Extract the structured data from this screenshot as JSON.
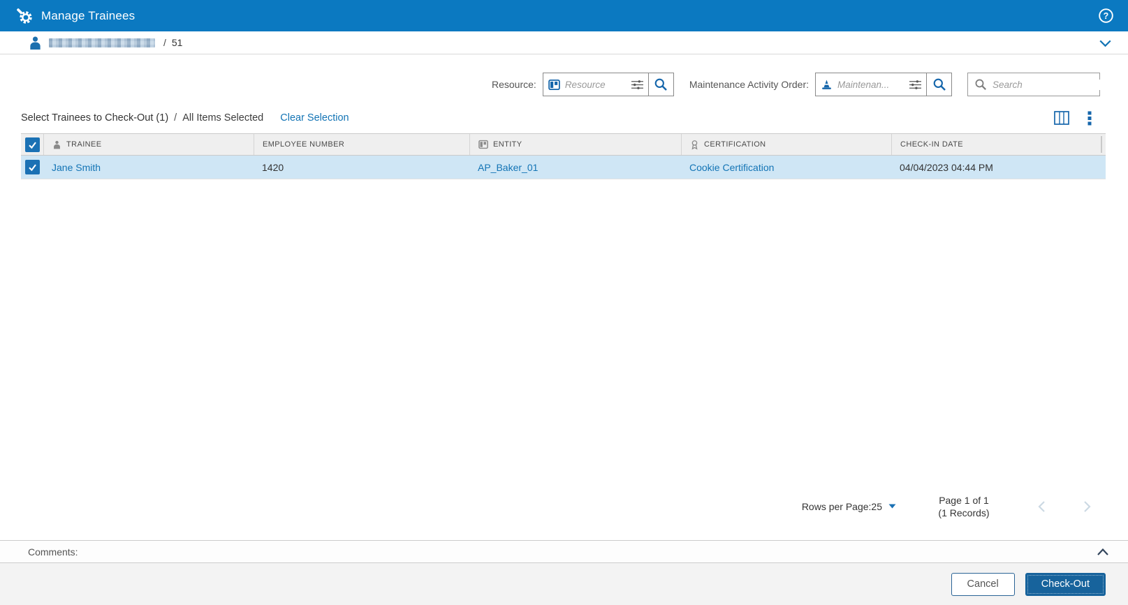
{
  "colors": {
    "titlebar_bg": "#0b79c1",
    "link_blue": "#1374b5",
    "icon_blue": "#1566ab",
    "selected_row_bg": "#cfe6f5",
    "table_header_bg": "#efefef",
    "checkout_button_bg": "#17639c",
    "footer_bg": "#f3f3f3"
  },
  "titlebar": {
    "title": "Manage Trainees",
    "icons": [
      "gear-wrench-icon",
      "help-icon"
    ]
  },
  "breadcrumb": {
    "user_icon": "person-icon",
    "user_name_redacted": true,
    "separator": "/",
    "count": "51",
    "collapse_icon": "chevron-down-icon"
  },
  "filters": {
    "resource_label": "Resource:",
    "resource_placeholder": "Resource",
    "resource_icons": [
      "resource-icon",
      "sliders-icon",
      "search-icon"
    ],
    "mao_label": "Maintenance Activity Order:",
    "mao_placeholder": "Maintenan...",
    "mao_icons": [
      "cone-icon",
      "sliders-icon",
      "search-icon"
    ],
    "search_placeholder": "Search",
    "search_icon": "search-icon"
  },
  "selection": {
    "title": "Select Trainees to Check-Out (1)",
    "separator": "/",
    "all_selected_label": "All Items Selected",
    "clear_label": "Clear Selection",
    "toolbar_icons": [
      "column-chooser-icon",
      "kebab-menu-icon"
    ]
  },
  "table": {
    "select_all_checked": true,
    "columns": [
      {
        "label": "TRAINEE",
        "icon": "person-icon"
      },
      {
        "label": "EMPLOYEE NUMBER",
        "icon": null
      },
      {
        "label": "ENTITY",
        "icon": "entity-icon"
      },
      {
        "label": "CERTIFICATION",
        "icon": "certification-icon"
      },
      {
        "label": "CHECK-IN DATE",
        "icon": null
      }
    ],
    "rows": [
      {
        "selected": true,
        "trainee": "Jane Smith",
        "employee_number": "1420",
        "entity": "AP_Baker_01",
        "certification": "Cookie Certification",
        "check_in_date": "04/04/2023 04:44 PM"
      }
    ]
  },
  "pagination": {
    "rows_per_page_label": "Rows per Page:",
    "rows_per_page_value": "25",
    "page_info": "Page 1 of 1",
    "records_info": "(1 Records)",
    "prev_icon": "chevron-left-icon",
    "next_icon": "chevron-right-icon"
  },
  "comments": {
    "label": "Comments:",
    "collapse_icon": "chevron-up-icon"
  },
  "footer": {
    "cancel_label": "Cancel",
    "checkout_label": "Check-Out"
  }
}
